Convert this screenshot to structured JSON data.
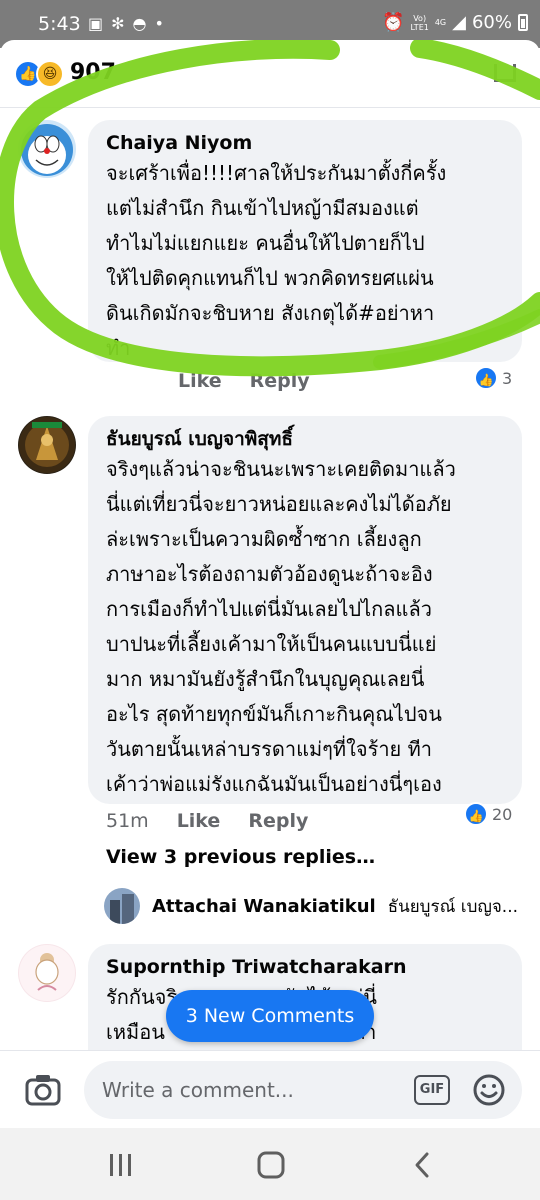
{
  "status_bar": {
    "time": "5:43",
    "network_top": "Vo)",
    "network_bottom": "LTE1",
    "network_gen": "4G",
    "battery": "60%",
    "icons": [
      "image-icon",
      "slack-icon",
      "chat-icon",
      "dot-icon",
      "alarm-icon",
      "signal-icon",
      "battery-icon"
    ]
  },
  "reactions": {
    "count": "907",
    "icons": [
      "like-icon",
      "haha-icon"
    ]
  },
  "comments": [
    {
      "author": "Chaiya Niyom",
      "text": "จะเศร้าเพื่อ!!!!ศาลให้ประกันมาตั้งกี่ครั้ง\nแต่ไม่สำนึก กินเข้าไปหญ้ามีสมองแต่\nทำไมไม่แยกแยะ คนอื่นให้ไปตายก็ไป\nให้ไปติดคุกแทนก็ไป พวกคิดทรยศแผ่น\nดินเกิดมักจะชิบหาย สังเกตุได้#อย่าหา\nทำ",
      "like_label": "Like",
      "reply_label": "Reply",
      "reaction_count": "3"
    },
    {
      "author": "ธันยบูรณ์ เบญจาพิสุทธิ์",
      "text": "จริงๆแล้วน่าจะชินนะเพราะเคยติดมาแล้ว\nนี่แต่เที่ยวนี่จะยาวหน่อยและคงไม่ได้อภัย\nล่ะเพราะเป็นความผิดซ้ำซาก เลี้ยงลูก\nภาษาอะไรต้องถามตัวอ้องดูนะถ้าจะอิง\nการเมืองก็ทำไปแต่นี่มันเลยไปไกลแล้ว\nบาปนะที่เลี้ยงเค้ามาให้เป็นคนแบบนี่แย่\nมาก หมามันยังรู้สำนึกในบุญคุณเลยนี่\nอะไร สุดท้ายทุกข์มันก็เกาะกินคุณไปจน\nวันตายนั้นเหล่าบรรดาแม่ๆที่ใจร้าย ทีา\nเค้าว่าพ่อแม่รังแกฉันมันเป็นอย่างนี่ๆเอง",
      "time": "51m",
      "like_label": "Like",
      "reply_label": "Reply",
      "reaction_count": "20",
      "view_previous": "View 3 previous replies…",
      "latest_reply": {
        "author": "Attachai Wanakiatikul",
        "snippet": "ธันยบูรณ์ เบญจ..."
      }
    },
    {
      "author": "Supornthip Triwatcharakarn",
      "text": "รักกันจริง               กันได้ แต่นี่\nเหมือน                    กรรมที่ทำ"
    }
  ],
  "new_comments_label": "3 New Comments",
  "composer": {
    "placeholder": "Write a comment...",
    "gif_label": "GIF"
  },
  "colors": {
    "marker": "#7ed321",
    "accent": "#1877f2",
    "bubble": "#f0f2f5",
    "meta": "#65676b"
  }
}
